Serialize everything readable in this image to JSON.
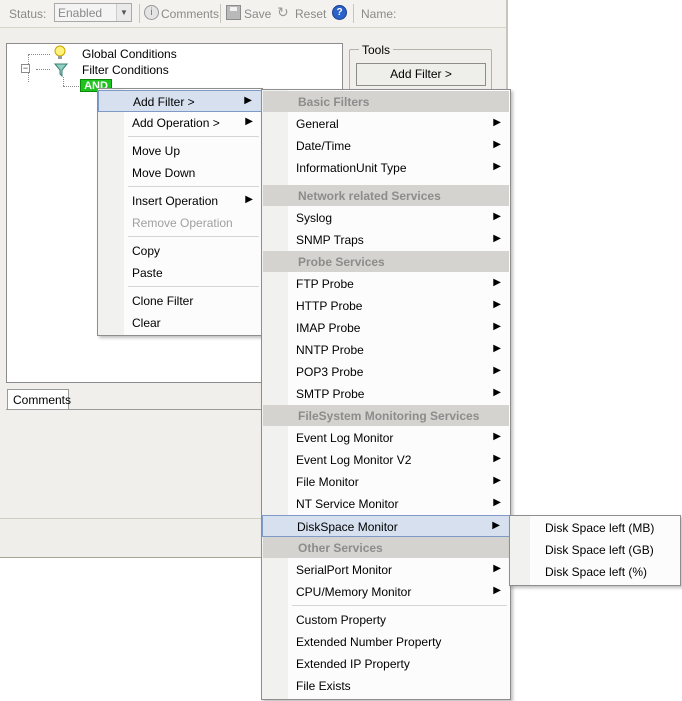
{
  "toolbar": {
    "status_label": "Status:",
    "status_value": "Enabled",
    "comments_label": "Comments",
    "save_label": "Save",
    "reset_label": "Reset",
    "name_label": "Name:"
  },
  "tree": {
    "global_conditions": "Global Conditions",
    "filter_conditions": "Filter Conditions",
    "and_node": "AND"
  },
  "tools": {
    "title": "Tools",
    "add_filter_button": "Add Filter >"
  },
  "comments_tab": "Comments",
  "context_menu": {
    "items": [
      {
        "label": "Add Filter >",
        "submenu": true
      },
      {
        "label": "Add Operation >",
        "submenu": true
      },
      {
        "label": "Move Up"
      },
      {
        "label": "Move Down"
      },
      {
        "label": "Insert Operation",
        "submenu": true
      },
      {
        "label": "Remove Operation",
        "disabled": true
      },
      {
        "label": "Copy"
      },
      {
        "label": "Paste"
      },
      {
        "label": "Clone Filter"
      },
      {
        "label": "Clear"
      }
    ]
  },
  "filter_menu": {
    "headers": [
      "Basic Filters",
      "Network related Services",
      "Probe Services",
      "FileSystem Monitoring Services",
      "Other Services"
    ],
    "items": [
      {
        "label": "General"
      },
      {
        "label": "Date/Time"
      },
      {
        "label": "InformationUnit Type"
      },
      {
        "label": "Syslog"
      },
      {
        "label": "SNMP Traps"
      },
      {
        "label": "FTP Probe"
      },
      {
        "label": "HTTP Probe"
      },
      {
        "label": "IMAP Probe"
      },
      {
        "label": "NNTP Probe"
      },
      {
        "label": "POP3 Probe"
      },
      {
        "label": "SMTP Probe"
      },
      {
        "label": "Event Log Monitor"
      },
      {
        "label": "Event Log Monitor V2"
      },
      {
        "label": "File Monitor"
      },
      {
        "label": "NT Service Monitor"
      },
      {
        "label": "DiskSpace Monitor"
      },
      {
        "label": "SerialPort Monitor"
      },
      {
        "label": "CPU/Memory Monitor"
      },
      {
        "label": "Custom Property"
      },
      {
        "label": "Extended Number Property"
      },
      {
        "label": "Extended IP Property"
      },
      {
        "label": "File Exists"
      }
    ]
  },
  "diskspace_menu": {
    "items": [
      {
        "label": "Disk Space left (MB)"
      },
      {
        "label": "Disk Space left (GB)"
      },
      {
        "label": "Disk Space left (%)"
      }
    ]
  },
  "colors": {
    "and_node": "#1ec31e",
    "menu_highlight": "#d6e0ef",
    "menu_header": "#d4d3cf"
  }
}
